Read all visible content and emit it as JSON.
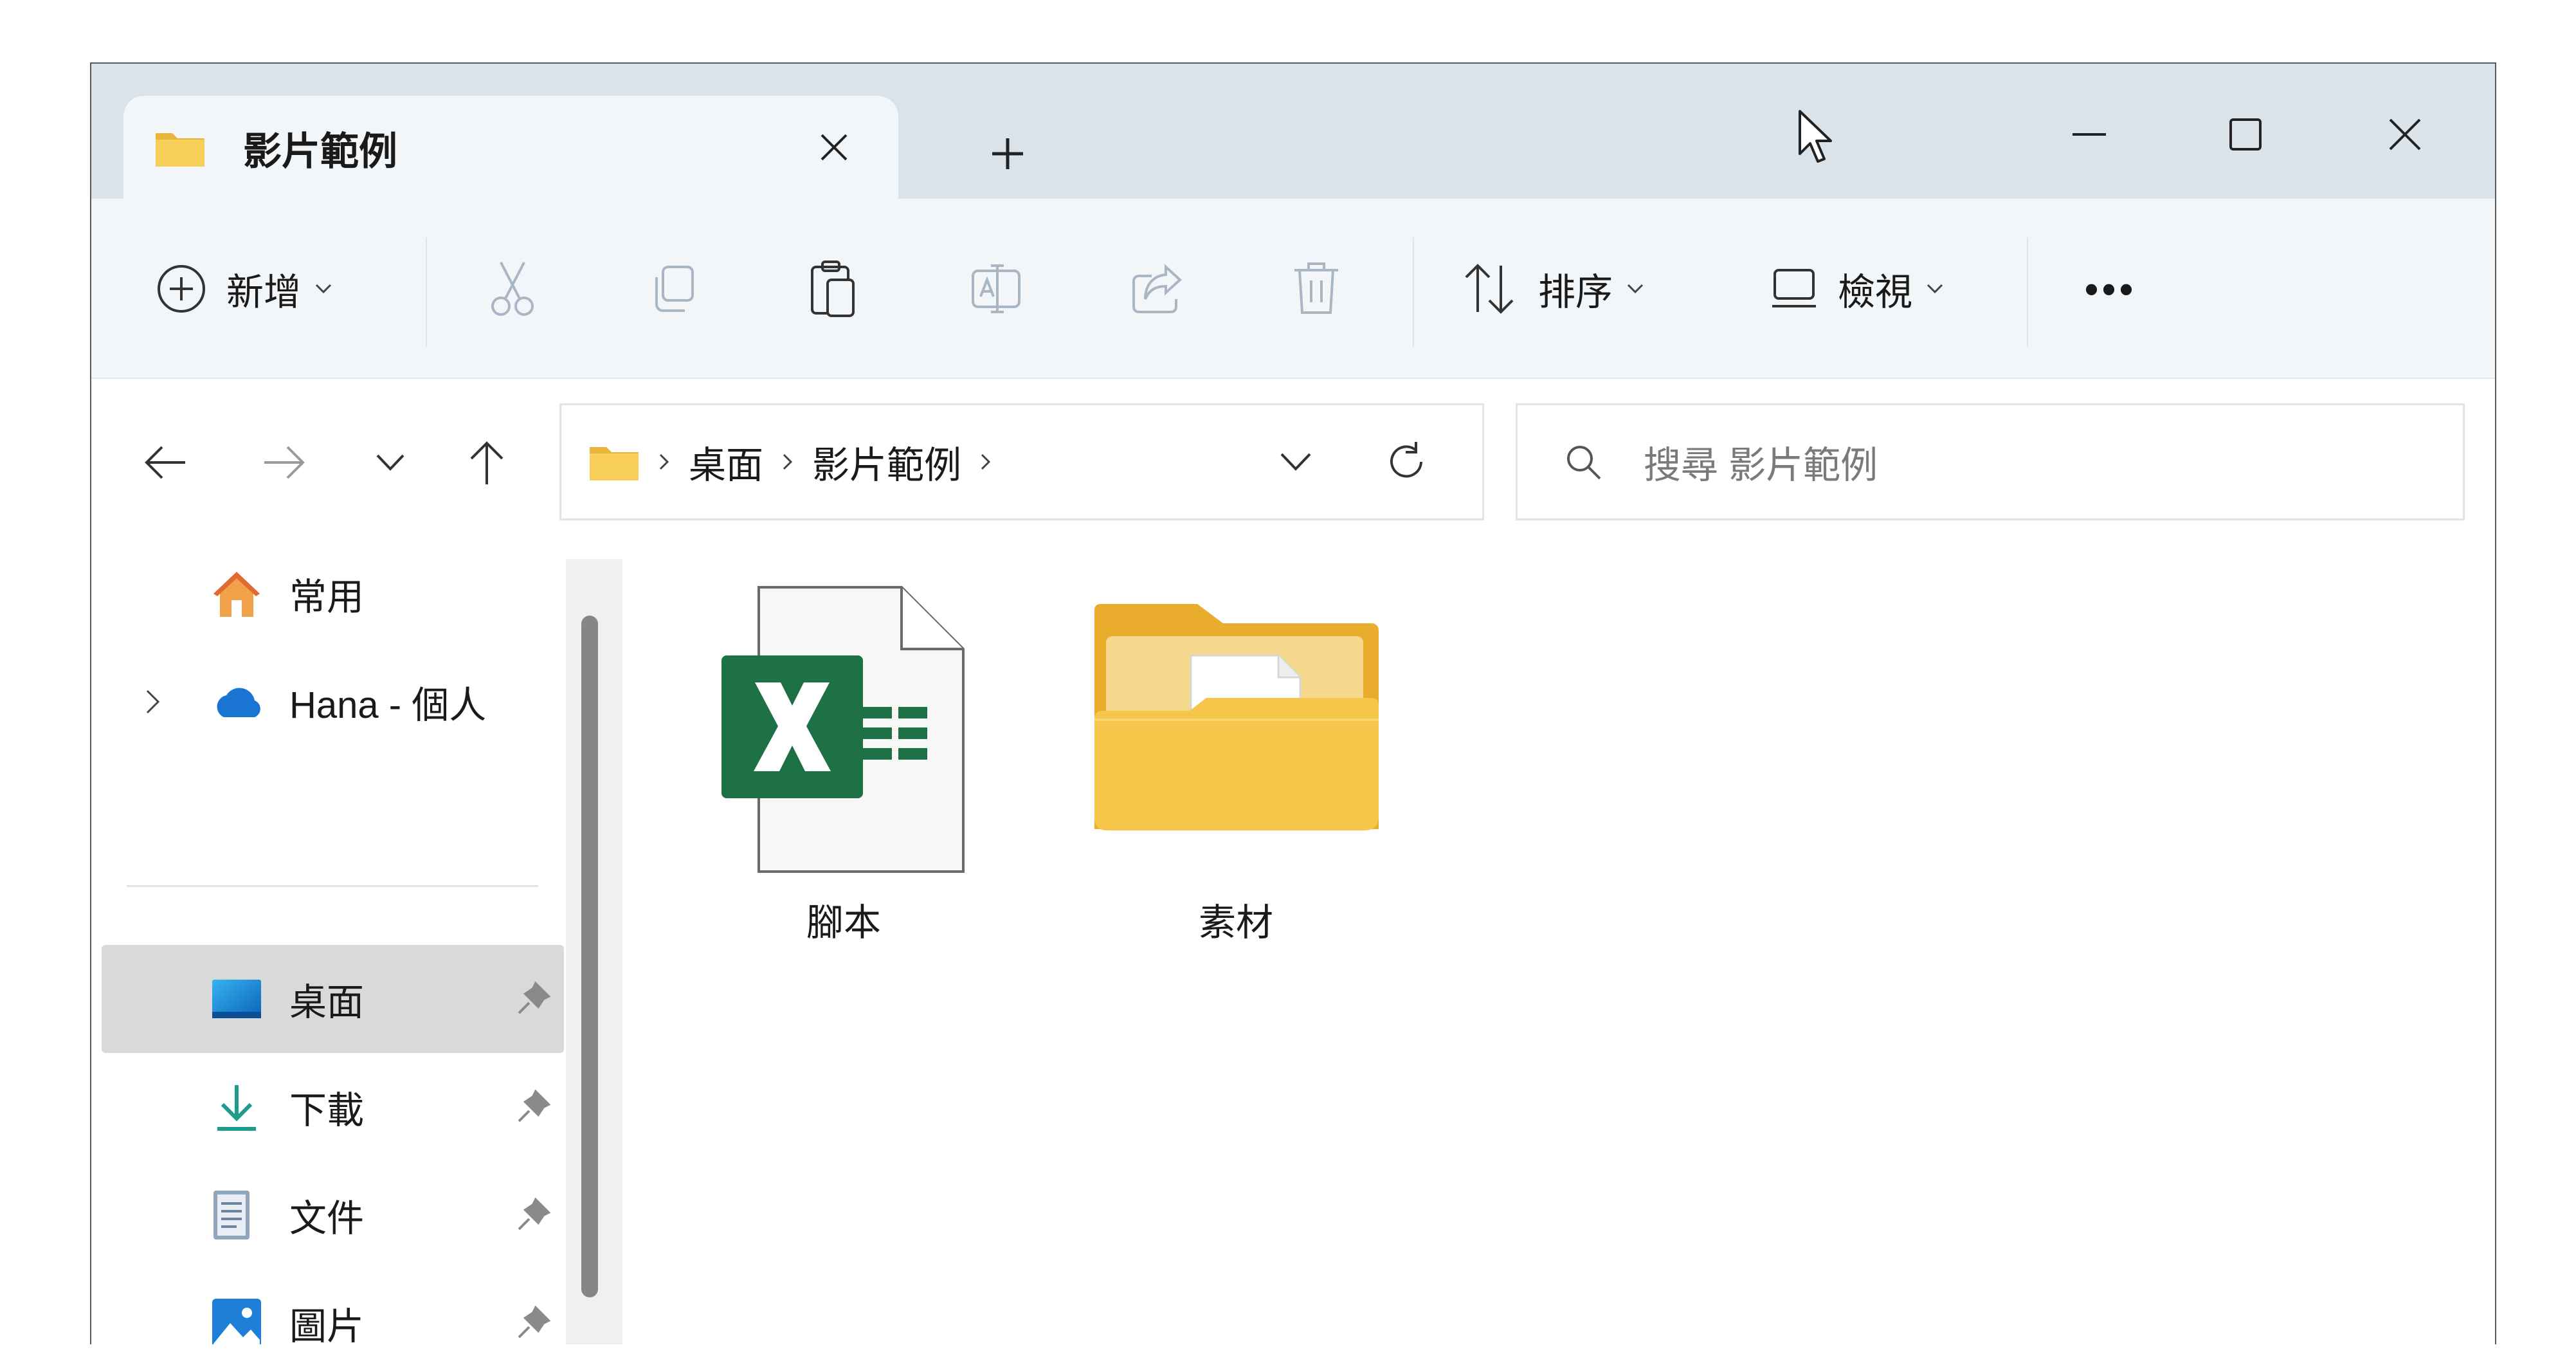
{
  "tab": {
    "title": "影片範例"
  },
  "toolbar": {
    "new_label": "新增",
    "sort_label": "排序",
    "view_label": "檢視",
    "more_label": "•••"
  },
  "address": {
    "crumbs": [
      "桌面",
      "影片範例"
    ]
  },
  "search": {
    "placeholder": "搜尋 影片範例"
  },
  "sidebar": {
    "items": [
      {
        "label": "常用",
        "icon": "home-icon"
      },
      {
        "label": "Hana - 個人",
        "icon": "onedrive-cloud-icon"
      },
      {
        "label": "桌面",
        "icon": "desktop-icon",
        "pinned": true,
        "active": true
      },
      {
        "label": "下載",
        "icon": "download-icon",
        "pinned": true
      },
      {
        "label": "文件",
        "icon": "document-icon",
        "pinned": true
      },
      {
        "label": "圖片",
        "icon": "pictures-icon",
        "pinned": true
      }
    ]
  },
  "files": [
    {
      "name": "腳本",
      "icon": "excel-file-icon"
    },
    {
      "name": "素材",
      "icon": "media-folder-icon"
    }
  ],
  "colors": {
    "titlebar": "#dbe3ea",
    "toolbar": "#f3f6f9",
    "excel_green": "#1e7145",
    "folder_yellow": "#f3c13a",
    "active_row": "#d9d9d9"
  }
}
